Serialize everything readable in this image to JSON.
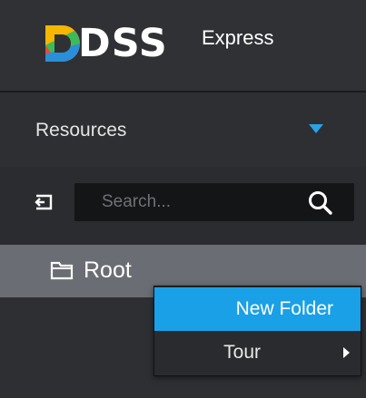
{
  "header": {
    "logo_main": "DSS",
    "logo_sub": "Express"
  },
  "resources": {
    "label": "Resources"
  },
  "search": {
    "placeholder": "Search...",
    "value": ""
  },
  "tree": {
    "root_label": "Root"
  },
  "context_menu": {
    "items": [
      {
        "label": "New Folder"
      },
      {
        "label": "Tour"
      }
    ]
  },
  "colors": {
    "accent": "#1aa0e6",
    "panel_bg": "#2a2c2f",
    "selected_row": "#6a6d73"
  },
  "icons": {
    "logo": "dss-logo-icon",
    "dropdown": "chevron-down-icon",
    "collapse": "collapse-icon",
    "search": "search-icon",
    "folder": "folder-icon",
    "submenu": "chevron-right-icon"
  }
}
